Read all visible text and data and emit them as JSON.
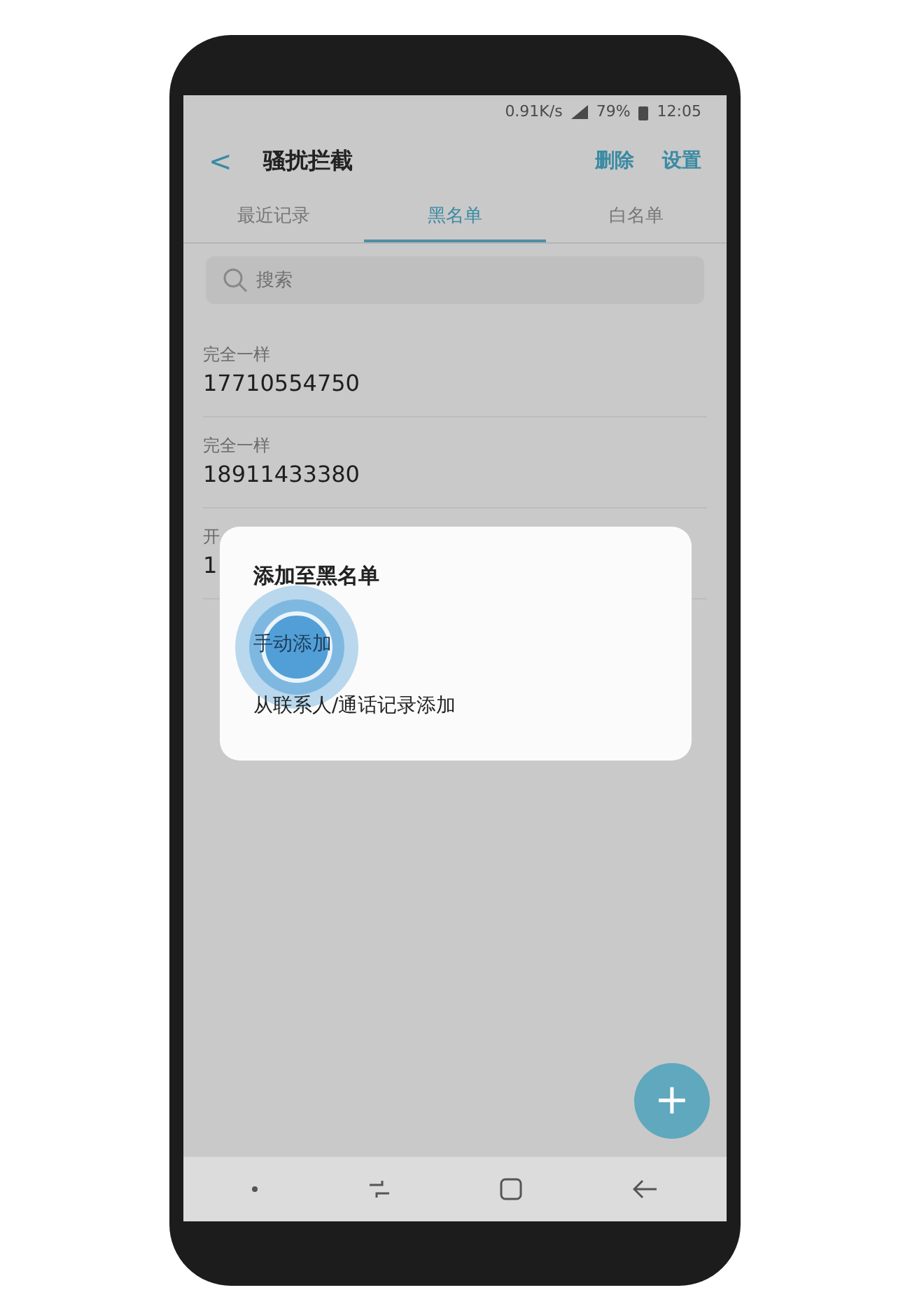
{
  "status_bar": {
    "speed": "0.91K/s",
    "battery": "79%",
    "time": "12:05"
  },
  "header": {
    "back": "<",
    "title": "骚扰拦截",
    "actions": [
      "删除",
      "设置"
    ]
  },
  "tabs": [
    {
      "label": "最近记录",
      "selected": false
    },
    {
      "label": "黑名单",
      "selected": true
    },
    {
      "label": "白名单",
      "selected": false
    }
  ],
  "search": {
    "placeholder": "搜索"
  },
  "rows": [
    {
      "label": "完全一样",
      "number": "17710554750"
    },
    {
      "label": "完全一样",
      "number": "18911433380"
    },
    {
      "label": "开",
      "number": "1"
    }
  ],
  "dialog": {
    "title": "添加至黑名单",
    "options": [
      {
        "label": "手动添加",
        "touched": true
      },
      {
        "label": "从联系人/通话记录添加",
        "touched": false
      }
    ]
  },
  "fab": {
    "label": "+"
  }
}
